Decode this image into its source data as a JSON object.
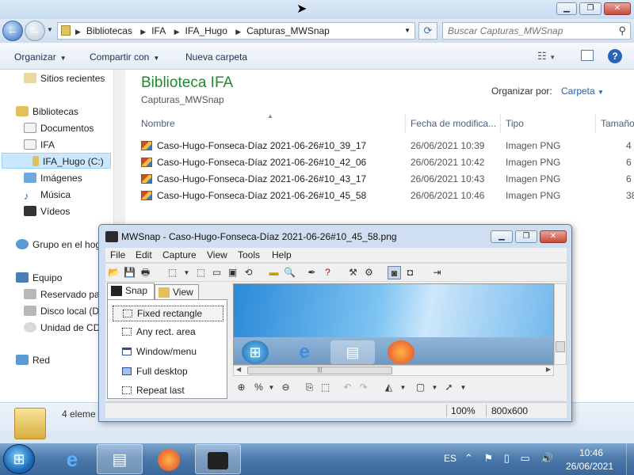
{
  "explorer": {
    "address": {
      "crumbs": [
        "Bibliotecas",
        "IFA",
        "IFA_Hugo",
        "Capturas_MWSnap"
      ]
    },
    "search_placeholder": "Buscar Capturas_MWSnap",
    "commands": {
      "organize": "Organizar",
      "share": "Compartir con",
      "new_folder": "Nueva carpeta"
    },
    "nav": {
      "recent": "Sitios recientes",
      "libraries": "Bibliotecas",
      "documents": "Documentos",
      "ifa": "IFA",
      "ifa_hugo": "IFA_Hugo (C:)",
      "images": "Imágenes",
      "music": "Música",
      "videos": "Vídeos",
      "homegroup": "Grupo en el hog",
      "computer": "Equipo",
      "reserved": "Reservado par",
      "local_disk": "Disco local (D",
      "cd_drive": "Unidad de CD",
      "network": "Red"
    },
    "library": {
      "title": "Biblioteca IFA",
      "subtitle": "Capturas_MWSnap",
      "arrange_label": "Organizar por:",
      "arrange_value": "Carpeta"
    },
    "columns": {
      "name": "Nombre",
      "modified": "Fecha de modifica...",
      "type": "Tipo",
      "size": "Tamaño"
    },
    "files": [
      {
        "name": "Caso-Hugo-Fonseca-Díaz 2021-06-26#10_39_17",
        "date": "26/06/2021 10:39",
        "type": "Imagen PNG",
        "size": "4"
      },
      {
        "name": "Caso-Hugo-Fonseca-Díaz 2021-06-26#10_42_06",
        "date": "26/06/2021 10:42",
        "type": "Imagen PNG",
        "size": "6"
      },
      {
        "name": "Caso-Hugo-Fonseca-Díaz 2021-06-26#10_43_17",
        "date": "26/06/2021 10:43",
        "type": "Imagen PNG",
        "size": "6"
      },
      {
        "name": "Caso-Hugo-Fonseca-Díaz 2021-06-26#10_45_58",
        "date": "26/06/2021 10:46",
        "type": "Imagen PNG",
        "size": "38"
      }
    ],
    "details_count": "4 eleme"
  },
  "mwsnap": {
    "title": "MWSnap - Caso-Hugo-Fonseca-Díaz 2021-06-26#10_45_58.png",
    "menu": [
      "File",
      "Edit",
      "Capture",
      "View",
      "Tools",
      "Help"
    ],
    "tabs": {
      "snap": "Snap",
      "view": "View"
    },
    "snap_modes": [
      "Fixed rectangle",
      "Any rect. area",
      "Window/menu",
      "Full desktop",
      "Repeat last"
    ],
    "status": {
      "zoom": "100%",
      "size": "800x600"
    }
  },
  "taskbar": {
    "language": "ES",
    "time": "10:46",
    "date": "26/06/2021"
  },
  "colors": {
    "library_title": "#1e8a2c",
    "link_blue": "#1e64b4",
    "taskbar": "#4d7aab"
  }
}
